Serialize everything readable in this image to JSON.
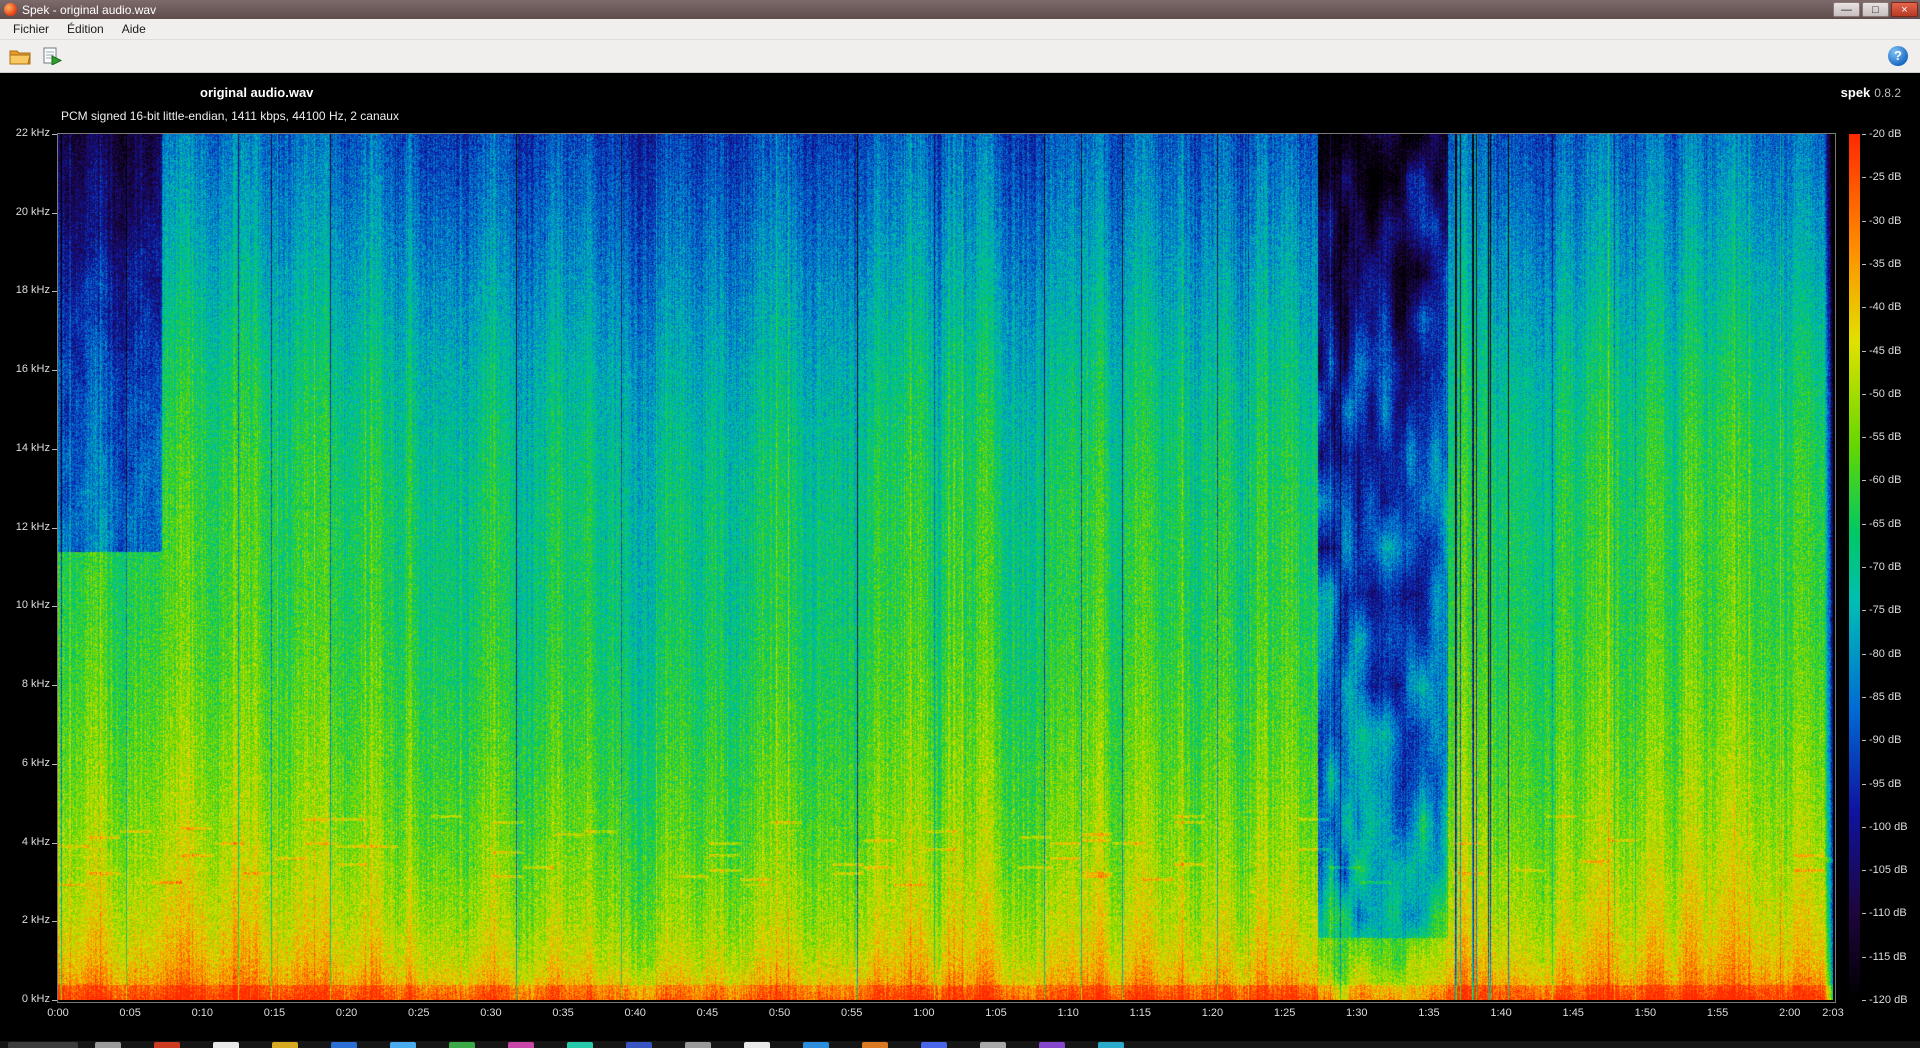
{
  "window": {
    "title": "Spek - original audio.wav",
    "minimize_glyph": "—",
    "maximize_glyph": "□",
    "close_glyph": "×"
  },
  "menu": {
    "items": [
      "Fichier",
      "Édition",
      "Aide"
    ]
  },
  "toolbar": {
    "help_glyph": "?"
  },
  "spectrogram": {
    "title": "original audio.wav",
    "app_name": "spek",
    "app_version": "0.8.2",
    "info": "PCM signed 16-bit little-endian, 1411 kbps, 44100 Hz, 2 canaux"
  },
  "chart_data": {
    "type": "heatmap",
    "title": "original audio.wav",
    "subtitle": "PCM signed 16-bit little-endian, 1411 kbps, 44100 Hz, 2 canaux",
    "x_axis": {
      "unit": "time",
      "range_seconds": [
        0,
        123
      ],
      "tick_seconds": [
        0,
        5,
        10,
        15,
        20,
        25,
        30,
        35,
        40,
        45,
        50,
        55,
        60,
        65,
        70,
        75,
        80,
        85,
        90,
        95,
        100,
        105,
        110,
        115,
        120,
        123
      ],
      "tick_labels": [
        "0:00",
        "0:05",
        "0:10",
        "0:15",
        "0:20",
        "0:25",
        "0:30",
        "0:35",
        "0:40",
        "0:45",
        "0:50",
        "0:55",
        "1:00",
        "1:05",
        "1:10",
        "1:15",
        "1:20",
        "1:25",
        "1:30",
        "1:35",
        "1:40",
        "1:45",
        "1:50",
        "1:55",
        "2:00",
        "2:03"
      ]
    },
    "y_axis": {
      "unit": "kHz",
      "range_khz": [
        0,
        22
      ],
      "tick_labels": [
        "22 kHz",
        "20 kHz",
        "18 kHz",
        "16 kHz",
        "14 kHz",
        "12 kHz",
        "10 kHz",
        "8 kHz",
        "6 kHz",
        "4 kHz",
        "2 kHz",
        "0 kHz"
      ]
    },
    "color_axis": {
      "unit": "dB",
      "range_db": [
        -20,
        -120
      ],
      "tick_labels": [
        "-20 dB",
        "-25 dB",
        "-30 dB",
        "-35 dB",
        "-40 dB",
        "-45 dB",
        "-50 dB",
        "-55 dB",
        "-60 dB",
        "-65 dB",
        "-70 dB",
        "-75 dB",
        "-80 dB",
        "-85 dB",
        "-90 dB",
        "-95 dB",
        "-100 dB",
        "-105 dB",
        "-110 dB",
        "-115 dB",
        "-120 dB"
      ]
    },
    "legend_position": "right",
    "palette": [
      "#000000",
      "#1e053c",
      "#0f14a0",
      "#006ed2",
      "#00beb4",
      "#00c864",
      "#64d700",
      "#e1e100",
      "#ff8c00",
      "#ff2800"
    ],
    "palette_stops": [
      0,
      0.1,
      0.22,
      0.34,
      0.46,
      0.54,
      0.64,
      0.76,
      0.87,
      1.0
    ],
    "content_features": {
      "quiet_intro_seconds": [
        0,
        7.2
      ],
      "quiet_section_seconds": [
        87.3,
        96.3
      ],
      "sparse_silent_columns_seconds": [
        96.3,
        101.5
      ]
    }
  },
  "taskbar": {
    "icon_colors": [
      "#9a9a9a",
      "#cc3a22",
      "#e8e8e8",
      "#d9a822",
      "#2b6fd4",
      "#49aaee",
      "#3aa844",
      "#c846a8",
      "#28c8aa",
      "#3956c0",
      "#9a9a9a",
      "#e8e8e8",
      "#2d8ddd",
      "#d97a22",
      "#4a66e8",
      "#a8a8a8",
      "#8646cc",
      "#2aaac8"
    ]
  }
}
